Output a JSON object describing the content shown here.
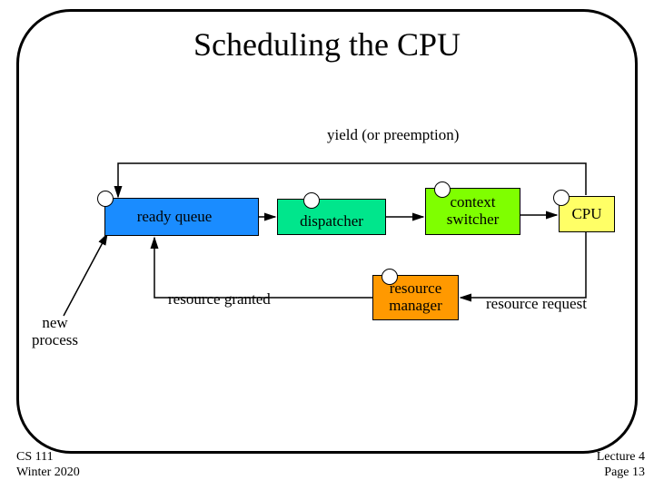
{
  "title": "Scheduling the CPU",
  "labels": {
    "yield": "yield (or preemption)",
    "ready_queue": "ready queue",
    "dispatcher": "dispatcher",
    "context_switcher_line1": "context",
    "context_switcher_line2": "switcher",
    "cpu": "CPU",
    "resource_manager_line1": "resource",
    "resource_manager_line2": "manager",
    "new_process_line1": "new",
    "new_process_line2": "process",
    "resource_granted": "resource granted",
    "resource_request": "resource request"
  },
  "footer": {
    "course": "CS 111",
    "term": "Winter 2020",
    "lecture": "Lecture 4",
    "page": "Page 13"
  }
}
